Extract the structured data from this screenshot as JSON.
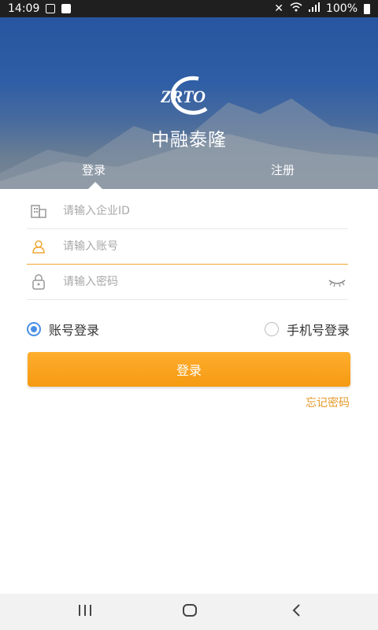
{
  "status_bar": {
    "time": "14:09",
    "battery": "100%"
  },
  "brand": {
    "logo_text": "ZRTO",
    "name": "中融泰隆"
  },
  "tabs": {
    "login": "登录",
    "register": "注册"
  },
  "form": {
    "company_id_placeholder": "请输入企业ID",
    "account_placeholder": "请输入账号",
    "password_placeholder": "请输入密码"
  },
  "login_mode": {
    "account_label": "账号登录",
    "phone_label": "手机号登录",
    "selected": "account"
  },
  "login_button_label": "登录",
  "forgot_password_label": "忘记密码",
  "colors": {
    "accent": "#f5a11c",
    "radio_active": "#4a8fe6",
    "hero_blue": "#2f5ea6"
  }
}
